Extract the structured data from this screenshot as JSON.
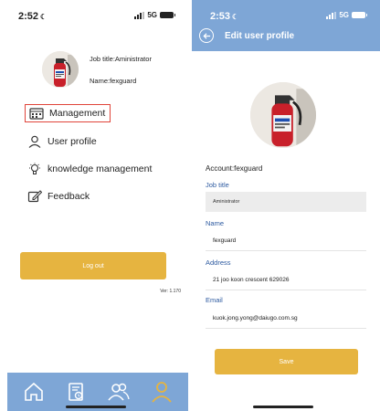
{
  "left": {
    "status": {
      "time": "2:52",
      "network": "5G"
    },
    "profile": {
      "job_title": "Job title:Aministrator",
      "name": "Name:fexguard"
    },
    "menu": [
      {
        "label": "Management",
        "icon": "calendar-grid-icon"
      },
      {
        "label": "User profile",
        "icon": "user-icon"
      },
      {
        "label": "knowledge management",
        "icon": "lightbulb-icon"
      },
      {
        "label": "Feedback",
        "icon": "edit-icon"
      }
    ],
    "logout_label": "Log out",
    "version": "Ver: 1.170",
    "tabs": [
      "home-icon",
      "report-icon",
      "users-icon",
      "profile-icon"
    ]
  },
  "right": {
    "status": {
      "time": "2:53",
      "network": "5G"
    },
    "title": "Edit user profile",
    "account": "Account:fexguard",
    "fields": {
      "job_title": {
        "label": "Job title",
        "value": "Aministrator"
      },
      "name": {
        "label": "Name",
        "value": "fexguard"
      },
      "address": {
        "label": "Address",
        "value": "21 joo koon crescent 629026"
      },
      "email": {
        "label": "Email",
        "value": "kuok.jong.yong@daiugo.com.sg"
      }
    },
    "save_label": "Save"
  },
  "colors": {
    "accent_blue": "#7ea6d6",
    "button_yellow": "#e6b440",
    "label_blue": "#2d5aa0",
    "highlight_red": "#e0443a"
  }
}
